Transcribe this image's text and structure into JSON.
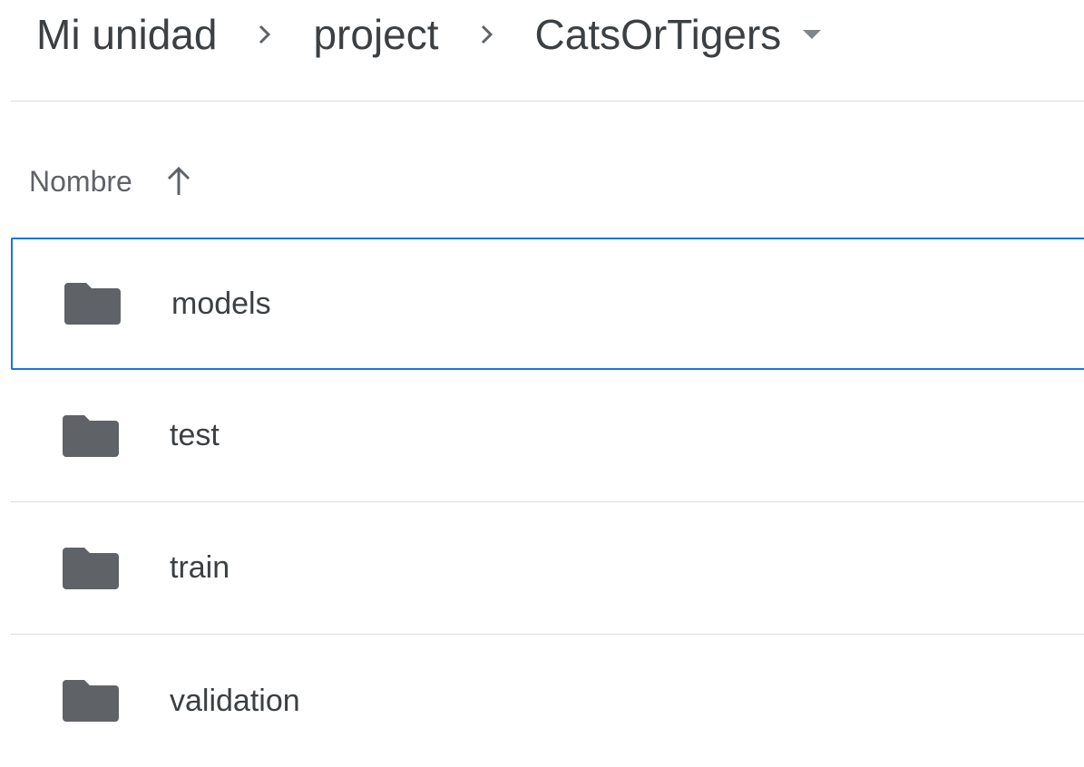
{
  "breadcrumb": {
    "items": [
      {
        "label": "Mi unidad"
      },
      {
        "label": "project"
      },
      {
        "label": "CatsOrTigers"
      }
    ]
  },
  "list_header": {
    "column_name": "Nombre",
    "sort": "ascending"
  },
  "files": [
    {
      "name": "models",
      "type": "folder",
      "selected": true
    },
    {
      "name": "test",
      "type": "folder",
      "selected": false
    },
    {
      "name": "train",
      "type": "folder",
      "selected": false
    },
    {
      "name": "validation",
      "type": "folder",
      "selected": false
    }
  ],
  "colors": {
    "text": "#3c4043",
    "secondary_text": "#5f6368",
    "folder_icon": "#5f6368",
    "selection_border": "#1a73e8",
    "divider": "#dadce0"
  },
  "icons": {
    "separator": "chevron-right-icon",
    "dropdown": "caret-down-icon",
    "sort": "arrow-up-icon",
    "folder": "folder-icon"
  }
}
